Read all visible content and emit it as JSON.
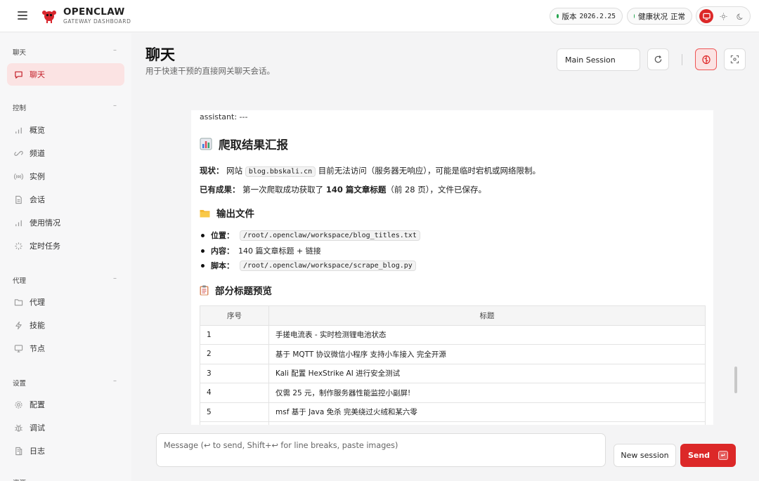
{
  "app": {
    "brand": "OPENCLAW",
    "subtitle": "GATEWAY DASHBOARD"
  },
  "status": {
    "version_label": "版本",
    "version_value": "2026.2.25",
    "health_label": "健康状况",
    "health_value": "正常",
    "dot_color": "#1fa34a",
    "accent_color": "#dc2828"
  },
  "sidebar": {
    "sections": [
      {
        "title": "聊天",
        "toggle": "–"
      },
      {
        "title": "控制",
        "toggle": "–"
      },
      {
        "title": "代理",
        "toggle": "–"
      },
      {
        "title": "设置",
        "toggle": "–"
      },
      {
        "title": "资源"
      }
    ],
    "items": [
      {
        "label": "聊天",
        "icon": "chat-icon",
        "active": true
      },
      {
        "label": "概览",
        "icon": "bar-chart-icon"
      },
      {
        "label": "频道",
        "icon": "link-icon"
      },
      {
        "label": "实例",
        "icon": "broadcast-icon"
      },
      {
        "label": "会话",
        "icon": "document-icon"
      },
      {
        "label": "使用情况",
        "icon": "bar-chart-icon"
      },
      {
        "label": "定时任务",
        "icon": "loader-icon"
      },
      {
        "label": "代理",
        "icon": "folder-icon"
      },
      {
        "label": "技能",
        "icon": "lightning-icon"
      },
      {
        "label": "节点",
        "icon": "monitor-icon"
      },
      {
        "label": "配置",
        "icon": "gear-icon"
      },
      {
        "label": "调试",
        "icon": "bug-icon"
      },
      {
        "label": "日志",
        "icon": "log-icon"
      }
    ]
  },
  "header": {
    "title": "聊天",
    "subtitle": "用于快速干预的直接网关聊天会话。",
    "session_value": "Main Session"
  },
  "message": {
    "head": "assistant: ---",
    "title": "爬取结果汇报",
    "status_label": "现状：",
    "status_pre": "网站",
    "status_code": "blog.bbskali.cn",
    "status_post": "目前无法访问（服务器无响应），可能是临时宕机或网络限制。",
    "result_label": "已有成果：",
    "result_pre": "第一次爬取成功获取了",
    "result_bold": "140 篇文章标题",
    "result_post": "（前 28 页），文件已保存。",
    "files_heading": "输出文件",
    "files": [
      {
        "label": "位置：",
        "code": "/root/.openclaw/workspace/blog_titles.txt"
      },
      {
        "label": "内容：",
        "text": "140 篇文章标题 + 链接"
      },
      {
        "label": "脚本：",
        "code": "/root/.openclaw/workspace/scrape_blog.py"
      }
    ],
    "preview_heading": "部分标题预览",
    "table": {
      "headers": [
        "序号",
        "标题"
      ],
      "rows": [
        [
          "1",
          "手搓电流表 - 实时检测锂电池状态"
        ],
        [
          "2",
          "基于 MQTT 协议微信小程序 支持小车接入 完全开源"
        ],
        [
          "3",
          "Kali 配置 HexStrike AI 进行安全测试"
        ],
        [
          "4",
          "仅需 25 元，制作服务器性能监控小副屏!"
        ],
        [
          "5",
          "msf 基于 Java 免杀 完美绕过火绒和某六零"
        ]
      ]
    }
  },
  "composer": {
    "placeholder": "Message (↩ to send, Shift+↩ for line breaks, paste images)",
    "new_session_label": "New session",
    "send_label": "Send",
    "send_key": "↵"
  }
}
